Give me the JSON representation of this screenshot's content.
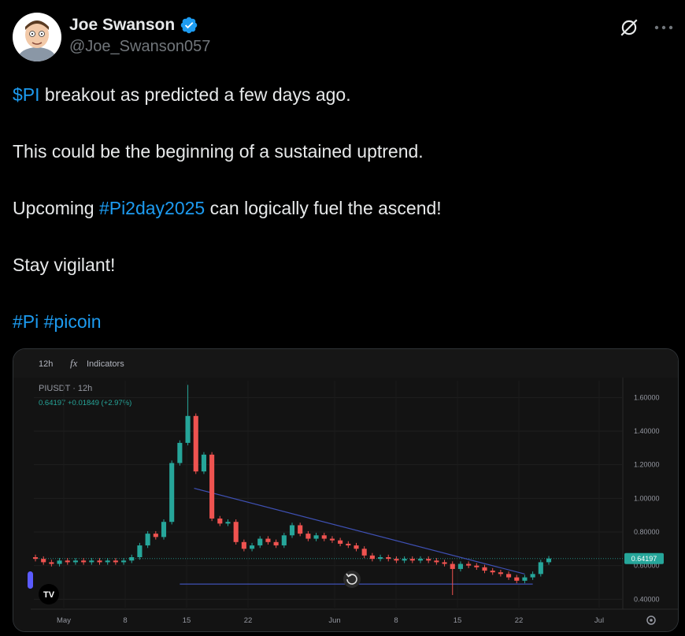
{
  "author": {
    "name": "Joe Swanson",
    "handle": "@Joe_Swanson057"
  },
  "icons": {
    "verified": "verified-badge-icon",
    "grok": "grok-icon",
    "more": "more-options-icon"
  },
  "colors": {
    "link": "#1d9bf0",
    "up": "#26a69a",
    "down": "#ef5350",
    "trendline": "#3f51b5",
    "price_tag": "#26a69a"
  },
  "tweet": {
    "line1_cashtag": "$PI",
    "line1_text": " breakout as predicted a few days ago.",
    "line2": "This could be the beginning of a sustained uptrend.",
    "line3_pre": "Upcoming ",
    "line3_hashtag": "#Pi2day2025",
    "line3_post": " can logically fuel the ascend!",
    "line4": "Stay vigilant!",
    "hashtag_pi": "#Pi",
    "hashtag_picoin": "#picoin"
  },
  "chart": {
    "interval": "12h",
    "indicators_label": "Indicators",
    "fx_symbol": "fx",
    "symbol_line": "PIUSDT · 12h",
    "price_line": "0.64197  +0.01849 (+2.97%)",
    "current_price": "0.64197",
    "tv_logo": "TV",
    "replay_icon": "replay-icon",
    "settings_icon": "settings-gear-icon",
    "y_ticks": [
      "1.60000",
      "1.40000",
      "1.20000",
      "1.00000",
      "0.80000",
      "0.60000",
      "0.40000"
    ],
    "x_ticks": [
      "May",
      "8",
      "15",
      "22",
      "Jun",
      "8",
      "15",
      "22",
      "Jul"
    ]
  },
  "chart_data": {
    "type": "candlestick",
    "symbol": "PIUSDT",
    "interval": "12h",
    "ylim": [
      0.35,
      1.7
    ],
    "y_ticks": [
      1.6,
      1.4,
      1.2,
      1.0,
      0.8,
      0.6,
      0.4
    ],
    "last_price": 0.64197,
    "change": 0.01849,
    "change_pct": 2.97,
    "candles_approx": [
      {
        "o": 0.65,
        "c": 0.64
      },
      {
        "o": 0.64,
        "c": 0.62
      },
      {
        "o": 0.62,
        "c": 0.61
      },
      {
        "o": 0.61,
        "c": 0.63
      },
      {
        "o": 0.63,
        "c": 0.62
      },
      {
        "o": 0.62,
        "c": 0.63
      },
      {
        "o": 0.63,
        "c": 0.62
      },
      {
        "o": 0.62,
        "c": 0.63
      },
      {
        "o": 0.63,
        "c": 0.62
      },
      {
        "o": 0.62,
        "c": 0.63
      },
      {
        "o": 0.63,
        "c": 0.62
      },
      {
        "o": 0.62,
        "c": 0.63
      },
      {
        "o": 0.63,
        "c": 0.65
      },
      {
        "o": 0.65,
        "c": 0.72
      },
      {
        "o": 0.72,
        "c": 0.79
      },
      {
        "o": 0.79,
        "c": 0.77
      },
      {
        "o": 0.77,
        "c": 0.86
      },
      {
        "o": 0.86,
        "c": 1.21
      },
      {
        "o": 1.21,
        "c": 1.33
      },
      {
        "o": 1.33,
        "c": 1.49
      },
      {
        "o": 1.49,
        "c": 1.16
      },
      {
        "o": 1.16,
        "c": 1.26
      },
      {
        "o": 1.26,
        "c": 0.88
      },
      {
        "o": 0.88,
        "c": 0.85
      },
      {
        "o": 0.85,
        "c": 0.86
      },
      {
        "o": 0.86,
        "c": 0.74
      },
      {
        "o": 0.74,
        "c": 0.7
      },
      {
        "o": 0.7,
        "c": 0.72
      },
      {
        "o": 0.72,
        "c": 0.76
      },
      {
        "o": 0.76,
        "c": 0.74
      },
      {
        "o": 0.74,
        "c": 0.72
      },
      {
        "o": 0.72,
        "c": 0.78
      },
      {
        "o": 0.78,
        "c": 0.84
      },
      {
        "o": 0.84,
        "c": 0.79
      },
      {
        "o": 0.79,
        "c": 0.76
      },
      {
        "o": 0.76,
        "c": 0.78
      },
      {
        "o": 0.78,
        "c": 0.76
      },
      {
        "o": 0.76,
        "c": 0.75
      },
      {
        "o": 0.75,
        "c": 0.73
      },
      {
        "o": 0.73,
        "c": 0.72
      },
      {
        "o": 0.72,
        "c": 0.7
      },
      {
        "o": 0.7,
        "c": 0.66
      },
      {
        "o": 0.66,
        "c": 0.64
      },
      {
        "o": 0.64,
        "c": 0.65
      },
      {
        "o": 0.65,
        "c": 0.64
      },
      {
        "o": 0.64,
        "c": 0.63
      },
      {
        "o": 0.63,
        "c": 0.64
      },
      {
        "o": 0.64,
        "c": 0.63
      },
      {
        "o": 0.63,
        "c": 0.64
      },
      {
        "o": 0.64,
        "c": 0.63
      },
      {
        "o": 0.63,
        "c": 0.62
      },
      {
        "o": 0.62,
        "c": 0.61
      },
      {
        "o": 0.61,
        "c": 0.58
      },
      {
        "o": 0.58,
        "c": 0.61
      },
      {
        "o": 0.61,
        "c": 0.6
      },
      {
        "o": 0.6,
        "c": 0.59
      },
      {
        "o": 0.59,
        "c": 0.57
      },
      {
        "o": 0.57,
        "c": 0.56
      },
      {
        "o": 0.56,
        "c": 0.55
      },
      {
        "o": 0.55,
        "c": 0.53
      },
      {
        "o": 0.53,
        "c": 0.51
      },
      {
        "o": 0.51,
        "c": 0.53
      },
      {
        "o": 0.53,
        "c": 0.55
      },
      {
        "o": 0.55,
        "c": 0.62
      },
      {
        "o": 0.62,
        "c": 0.64197
      }
    ]
  }
}
